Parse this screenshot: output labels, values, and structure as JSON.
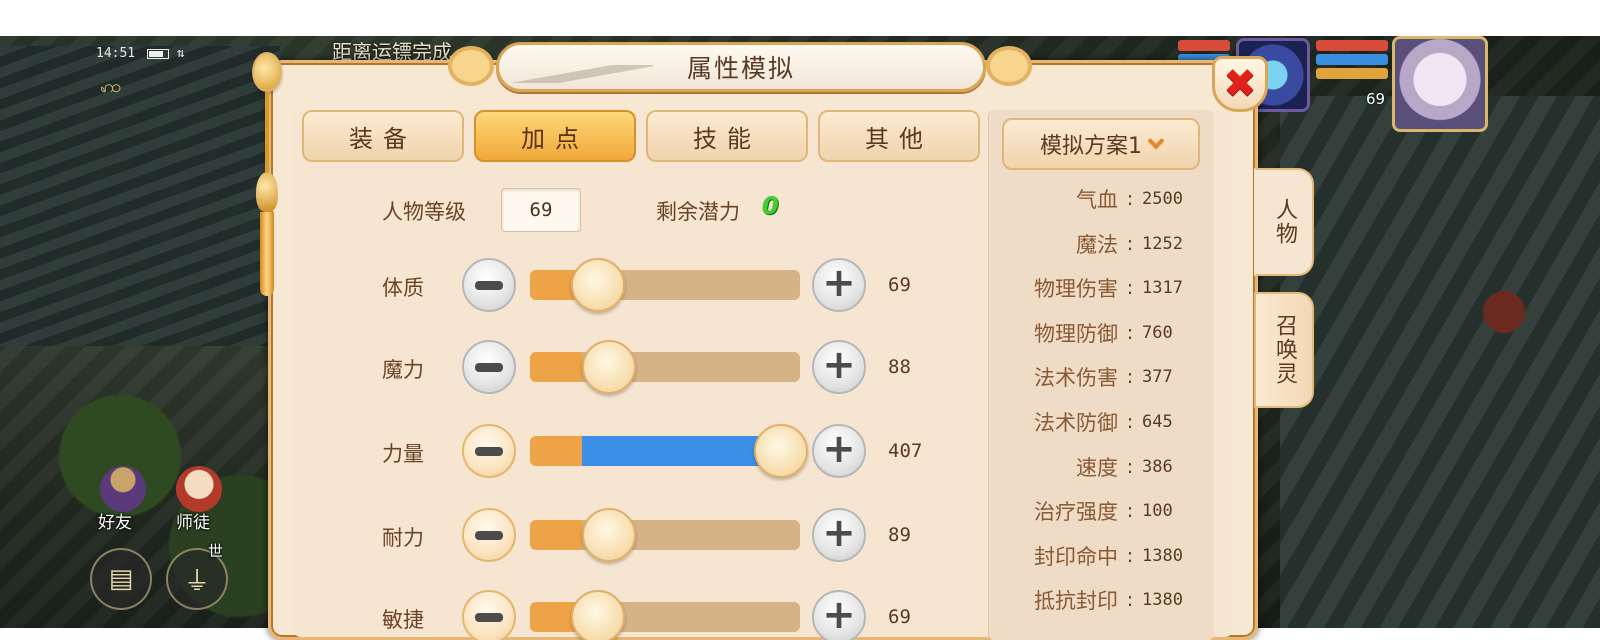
{
  "status": {
    "time": "14:51"
  },
  "top_notice": "距离运镖完成",
  "hud": {
    "friends_label": "好友",
    "mentor_label": "师徒",
    "world_tag": "世",
    "player_level": "69",
    "hp_bar_color": "#d84a3a",
    "mp_bar_color": "#3a8fe0"
  },
  "dialog": {
    "title": "属性模拟",
    "close_label": "✖",
    "tabs": [
      {
        "label": "装备",
        "active": false
      },
      {
        "label": "加点",
        "active": true
      },
      {
        "label": "技能",
        "active": false
      },
      {
        "label": "其他",
        "active": false
      }
    ],
    "level_label": "人物等级",
    "level_value": "69",
    "potential_label": "剩余潜力",
    "potential_value": "0",
    "attributes": [
      {
        "name": "体质",
        "value": "69",
        "level_fraction": 0.0
      },
      {
        "name": "魔力",
        "value": "88",
        "level_fraction": 0.06
      },
      {
        "name": "力量",
        "value": "407",
        "level_fraction": 1.0
      },
      {
        "name": "耐力",
        "value": "89",
        "level_fraction": 0.06
      },
      {
        "name": "敏捷",
        "value": "69",
        "level_fraction": 0.0
      }
    ],
    "scheme_label": "模拟方案1",
    "stats": [
      {
        "name": "气血",
        "value": "2500"
      },
      {
        "name": "魔法",
        "value": "1252"
      },
      {
        "name": "物理伤害",
        "value": "1317"
      },
      {
        "name": "物理防御",
        "value": "760"
      },
      {
        "name": "法术伤害",
        "value": "377"
      },
      {
        "name": "法术防御",
        "value": "645"
      },
      {
        "name": "速度",
        "value": "386"
      },
      {
        "name": "治疗强度",
        "value": "100"
      },
      {
        "name": "封印命中",
        "value": "1380"
      },
      {
        "name": "抵抗封印",
        "value": "1380"
      }
    ],
    "side_tabs": [
      {
        "label": "人物",
        "active": true
      },
      {
        "label": "召唤灵",
        "active": false
      }
    ],
    "colors": {
      "accent_orange": "#eea346",
      "fill_blue": "#3b8fe6",
      "potential_green": "#3fcf2f",
      "close_red": "#e2221a"
    }
  }
}
